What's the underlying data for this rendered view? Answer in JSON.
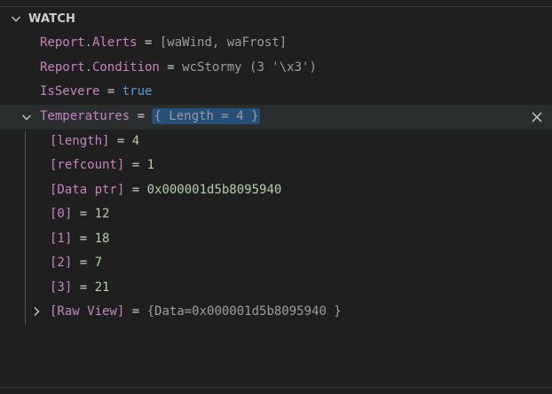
{
  "panel": {
    "title": "WATCH"
  },
  "watch": {
    "items": [
      {
        "name": "Report.Alerts",
        "eq": " = ",
        "value": "[waWind, waFrost]"
      },
      {
        "name": "Report.Condition",
        "eq": " = ",
        "value": "wcStormy (3 '\\x3')"
      },
      {
        "name": "IsSevere",
        "eq": " = ",
        "value": "true"
      },
      {
        "name": "Temperatures",
        "eq": " = ",
        "value": "{ Length = 4 }"
      }
    ],
    "children": [
      {
        "name": "[length]",
        "eq": " = ",
        "value": "4"
      },
      {
        "name": "[refcount]",
        "eq": " = ",
        "value": "1"
      },
      {
        "name": "[Data ptr]",
        "eq": " = ",
        "value": "0x000001d5b8095940"
      },
      {
        "name": "[0]",
        "eq": " = ",
        "value": "12"
      },
      {
        "name": "[1]",
        "eq": " = ",
        "value": "18"
      },
      {
        "name": "[2]",
        "eq": " = ",
        "value": "7"
      },
      {
        "name": "[3]",
        "eq": " = ",
        "value": "21"
      },
      {
        "name": "[Raw View]",
        "eq": " = ",
        "value": "{Data=0x000001d5b8095940 }"
      }
    ]
  },
  "colors": {
    "background": "#1f1f1f",
    "name": "#c586c0",
    "number": "#b5cea8",
    "keyword": "#569cd6",
    "selection": "#264f78"
  }
}
